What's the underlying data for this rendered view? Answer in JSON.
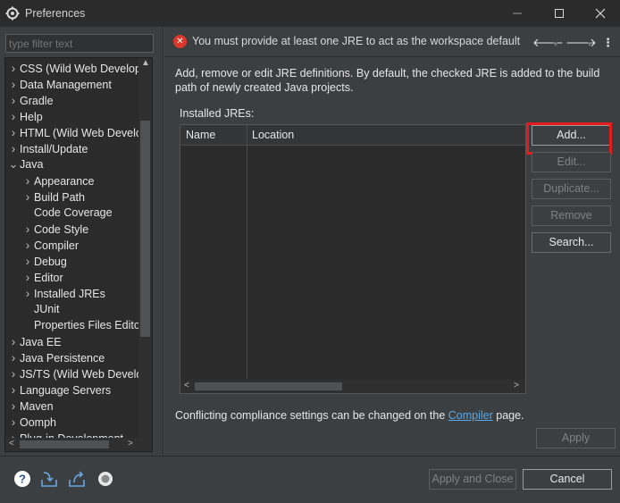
{
  "window": {
    "title": "Preferences",
    "minimize_icon": "minimize-icon",
    "maximize_icon": "maximize-icon",
    "close_icon": "close-icon"
  },
  "left": {
    "filter_placeholder": "type filter text",
    "tree": [
      {
        "label": "CSS (Wild Web Develop",
        "level": 0,
        "expander": "collapsed"
      },
      {
        "label": "Data Management",
        "level": 0,
        "expander": "collapsed"
      },
      {
        "label": "Gradle",
        "level": 0,
        "expander": "collapsed"
      },
      {
        "label": "Help",
        "level": 0,
        "expander": "collapsed"
      },
      {
        "label": "HTML (Wild Web Develo",
        "level": 0,
        "expander": "collapsed"
      },
      {
        "label": "Install/Update",
        "level": 0,
        "expander": "collapsed"
      },
      {
        "label": "Java",
        "level": 0,
        "expander": "expanded"
      },
      {
        "label": "Appearance",
        "level": 1,
        "expander": "collapsed"
      },
      {
        "label": "Build Path",
        "level": 1,
        "expander": "collapsed"
      },
      {
        "label": "Code Coverage",
        "level": 1,
        "expander": "none"
      },
      {
        "label": "Code Style",
        "level": 1,
        "expander": "collapsed"
      },
      {
        "label": "Compiler",
        "level": 1,
        "expander": "collapsed"
      },
      {
        "label": "Debug",
        "level": 1,
        "expander": "collapsed"
      },
      {
        "label": "Editor",
        "level": 1,
        "expander": "collapsed"
      },
      {
        "label": "Installed JREs",
        "level": 1,
        "expander": "collapsed"
      },
      {
        "label": "JUnit",
        "level": 1,
        "expander": "none"
      },
      {
        "label": "Properties Files Edito",
        "level": 1,
        "expander": "none"
      },
      {
        "label": "Java EE",
        "level": 0,
        "expander": "collapsed"
      },
      {
        "label": "Java Persistence",
        "level": 0,
        "expander": "collapsed"
      },
      {
        "label": "JS/TS (Wild Web Develo",
        "level": 0,
        "expander": "collapsed"
      },
      {
        "label": "Language Servers",
        "level": 0,
        "expander": "collapsed"
      },
      {
        "label": "Maven",
        "level": 0,
        "expander": "collapsed"
      },
      {
        "label": "Oomph",
        "level": 0,
        "expander": "collapsed"
      },
      {
        "label": "Plug-in Development",
        "level": 0,
        "expander": "collapsed"
      }
    ]
  },
  "right": {
    "error_message": "You must provide at least one JRE to act as the workspace default",
    "error_icon": "error-icon",
    "description": "Add, remove or edit JRE definitions. By default, the checked JRE is added to the build path of newly created Java projects.",
    "installed_label": "Installed JREs:",
    "columns": [
      "Name",
      "Location"
    ],
    "buttons": {
      "add": "Add...",
      "edit": "Edit...",
      "duplicate": "Duplicate...",
      "remove": "Remove",
      "search": "Search..."
    },
    "compliance_prefix": "Conflicting compliance settings can be changed on the ",
    "compliance_link": "Compiler",
    "compliance_suffix": " page.",
    "apply": "Apply"
  },
  "bottom": {
    "apply_and_close": "Apply and Close",
    "cancel": "Cancel"
  },
  "colors": {
    "highlight": "#e31b1b",
    "link": "#5aa9e6",
    "error": "#d9382a"
  }
}
